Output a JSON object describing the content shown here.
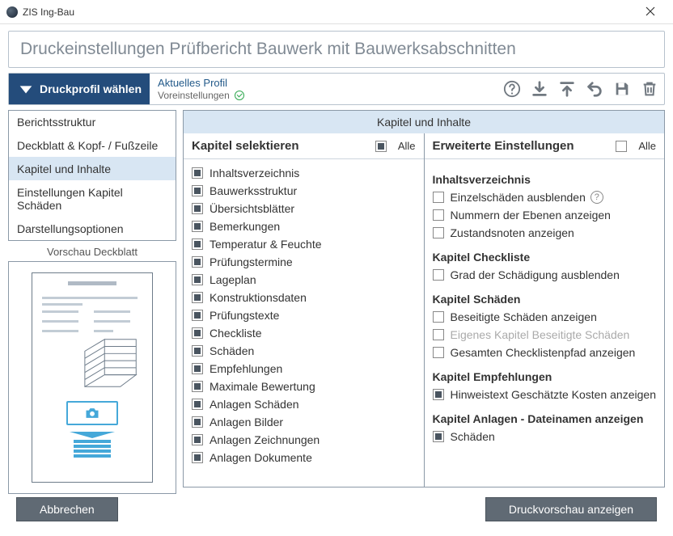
{
  "window": {
    "title": "ZIS Ing-Bau"
  },
  "page": {
    "heading": "Druckeinstellungen Prüfbericht Bauwerk mit Bauwerksabschnitten"
  },
  "toolbar": {
    "profile_button": "Druckprofil wählen",
    "profile_label": "Aktuelles Profil",
    "profile_value": "Voreinstellungen"
  },
  "nav": {
    "items": [
      "Berichtsstruktur",
      "Deckblatt & Kopf- / Fußzeile",
      "Kapitel und Inhalte",
      "Einstellungen Kapitel Schäden",
      "Darstellungsoptionen"
    ],
    "active": 2,
    "preview_label": "Vorschau Deckblatt"
  },
  "right": {
    "header": "Kapitel und Inhalte"
  },
  "left_panel": {
    "title": "Kapitel selektieren",
    "all_label": "Alle",
    "items": [
      "Inhaltsverzeichnis",
      "Bauwerksstruktur",
      "Übersichtsblätter",
      "Bemerkungen",
      "Temperatur & Feuchte",
      "Prüfungstermine",
      "Lageplan",
      "Konstruktionsdaten",
      "Prüfungstexte",
      "Checkliste",
      "Schäden",
      "Empfehlungen",
      "Maximale Bewertung",
      "Anlagen Schäden",
      "Anlagen Bilder",
      "Anlagen Zeichnungen",
      "Anlagen Dokumente"
    ]
  },
  "right_panel": {
    "title": "Erweiterte Einstellungen",
    "all_label": "Alle",
    "groups": [
      {
        "heading": "Inhaltsverzeichnis",
        "items": [
          {
            "label": "Einzelschäden ausblenden",
            "state": "unchecked",
            "help": true
          },
          {
            "label": "Nummern der Ebenen anzeigen",
            "state": "unchecked"
          },
          {
            "label": "Zustandsnoten anzeigen",
            "state": "unchecked"
          }
        ]
      },
      {
        "heading": "Kapitel Checkliste",
        "items": [
          {
            "label": "Grad der Schädigung ausblenden",
            "state": "unchecked"
          }
        ]
      },
      {
        "heading": "Kapitel Schäden",
        "items": [
          {
            "label": "Beseitigte Schäden anzeigen",
            "state": "unchecked"
          },
          {
            "label": "Eigenes Kapitel Beseitigte Schäden",
            "state": "unchecked",
            "disabled": true
          },
          {
            "label": "Gesamten Checklistenpfad anzeigen",
            "state": "unchecked"
          }
        ]
      },
      {
        "heading": "Kapitel Empfehlungen",
        "items": [
          {
            "label": "Hinweistext Geschätzte Kosten anzeigen",
            "state": "indeterminate"
          }
        ]
      },
      {
        "heading": "Kapitel Anlagen - Dateinamen anzeigen",
        "items": [
          {
            "label": "Schäden",
            "state": "indeterminate"
          }
        ]
      }
    ]
  },
  "footer": {
    "cancel": "Abbrechen",
    "preview": "Druckvorschau anzeigen"
  }
}
